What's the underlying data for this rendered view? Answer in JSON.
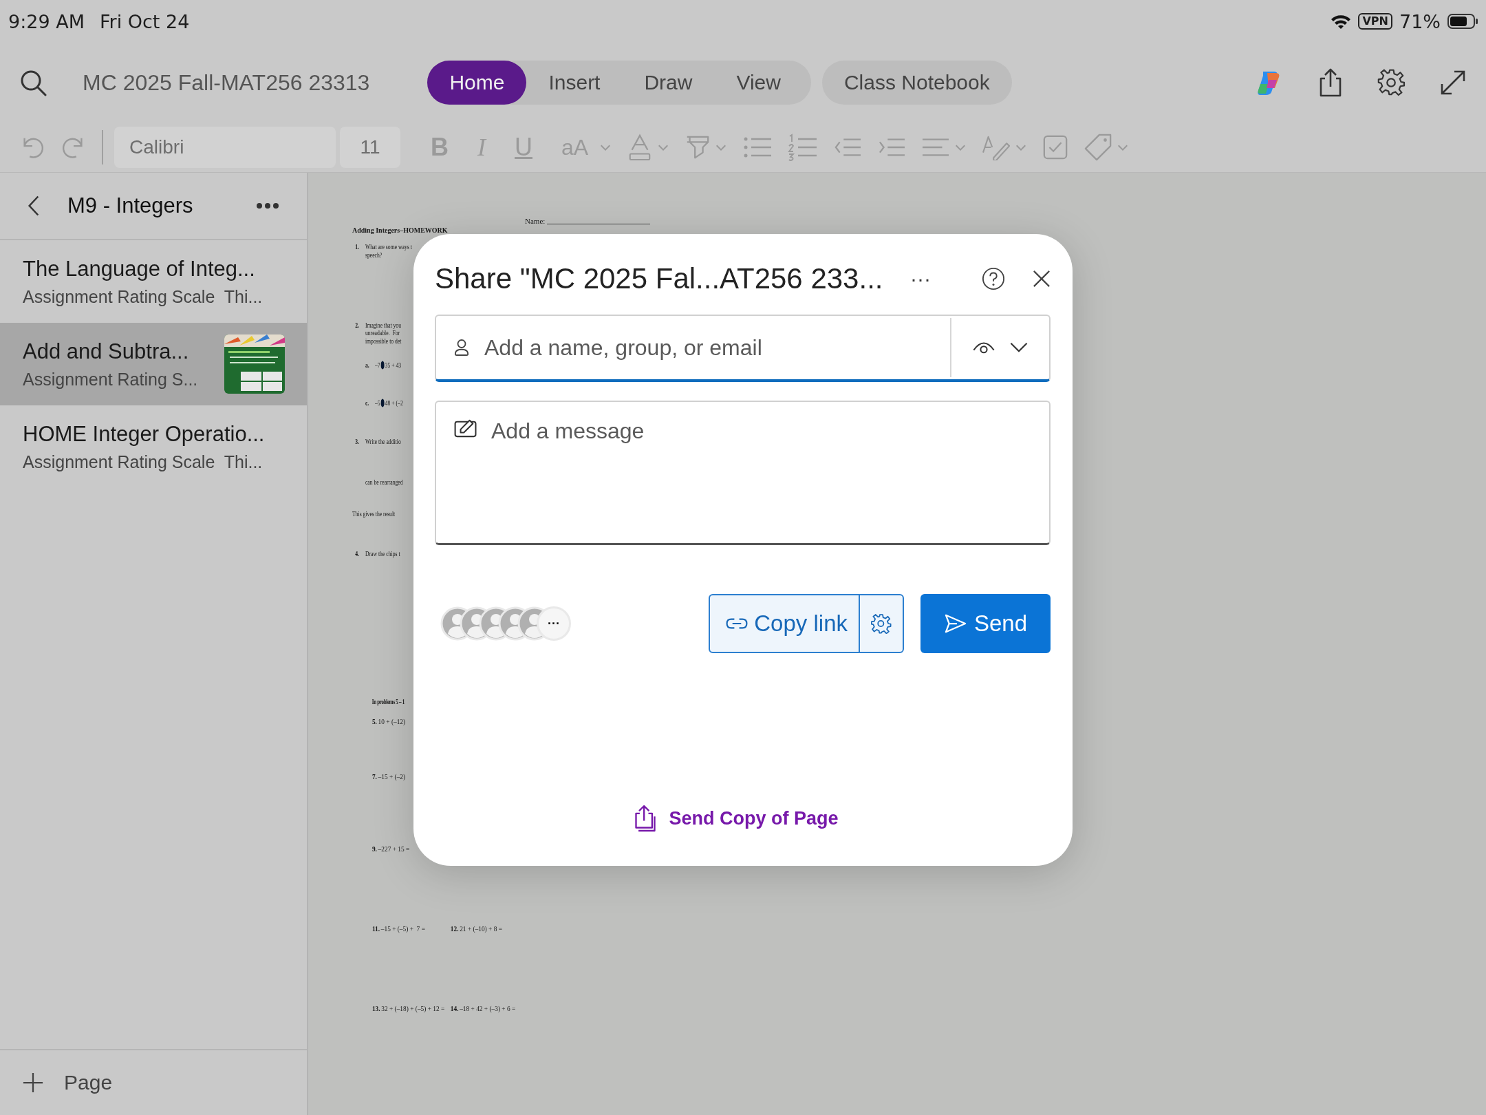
{
  "status_bar": {
    "time": "9:29 AM",
    "date": "Fri Oct 24",
    "vpn": "VPN",
    "battery": "71%"
  },
  "header": {
    "notebook_title": "MC 2025 Fall-MAT256 23313",
    "tabs": [
      {
        "label": "Home",
        "selected": true
      },
      {
        "label": "Insert",
        "selected": false
      },
      {
        "label": "Draw",
        "selected": false
      },
      {
        "label": "View",
        "selected": false
      }
    ],
    "class_notebook": "Class Notebook"
  },
  "toolbar": {
    "disabled": true,
    "font": "Calibri",
    "size": "11",
    "format_buttons": [
      {
        "kind": "bold",
        "label": "B"
      },
      {
        "kind": "italic",
        "label": "I"
      },
      {
        "kind": "underline",
        "label": "U"
      },
      {
        "kind": "case",
        "label": "aA"
      }
    ]
  },
  "sidebar": {
    "section": "M9 - Integers",
    "pages": [
      {
        "title": "The Language of Integ...",
        "subtitle": "Assignment Rating Scale  Thi...",
        "selected": false
      },
      {
        "title": "Add and Subtra...",
        "subtitle": "Assignment Rating S...",
        "selected": true
      },
      {
        "title": "HOME Integer Operatio...",
        "subtitle": "Assignment Rating Scale  Thi...",
        "selected": false
      }
    ],
    "add_page": "Page"
  },
  "document": {
    "name_label": "Name:",
    "heading": "Adding Integers–HOMEWORK",
    "lines": [
      {
        "kind": "item",
        "num": "1.",
        "text": "What are some ways t"
      },
      {
        "kind": "cont",
        "text": "speech?"
      },
      {
        "kind": "item",
        "num": "2.",
        "text": "Imagine that you"
      },
      {
        "kind": "cont",
        "text": "unreadable.  For"
      },
      {
        "kind": "cont",
        "text": "impossible to det"
      },
      {
        "kind": "blot",
        "num": "a.",
        "before": "–7",
        "after": "35 + 43"
      },
      {
        "kind": "blot",
        "num": "c.",
        "before": "–5",
        "after": "48 + (–2"
      },
      {
        "kind": "item",
        "num": "3.",
        "text": "Write the additio"
      },
      {
        "kind": "cont",
        "text": "can be rearranged"
      },
      {
        "kind": "plain",
        "text": "This gives the result"
      },
      {
        "kind": "item",
        "num": "4.",
        "text": "Draw the chips t"
      },
      {
        "kind": "section",
        "text": "In problems 5 – 1"
      },
      {
        "kind": "problem",
        "problems": [
          {
            "num": "5.",
            "text": "10 + (–12)"
          }
        ]
      },
      {
        "kind": "problem",
        "problems": [
          {
            "num": "7.",
            "text": "–15 + (–2)"
          }
        ]
      },
      {
        "kind": "problem",
        "problems": [
          {
            "num": "9.",
            "text": "–227 + 15 ="
          }
        ]
      },
      {
        "kind": "problem",
        "problems": [
          {
            "num": "11.",
            "text": "–15 + (–5) +  7 ="
          },
          {
            "num": "12.",
            "text": "21 + (–10) + 8 ="
          }
        ]
      },
      {
        "kind": "problem",
        "problems": [
          {
            "num": "13.",
            "text": "32 + (–18) + (–5) + 12 ="
          },
          {
            "num": "14.",
            "text": "–18 + 42 + (–3) + 6 ="
          }
        ]
      }
    ]
  },
  "share_dialog": {
    "title": "Share \"MC 2025 Fal...AT256 233...",
    "more": "···",
    "recipient": {
      "placeholder": "Add a name, group, or email"
    },
    "message": {
      "placeholder": "Add a message"
    },
    "more_people": "···",
    "copy_link": "Copy link",
    "send": "Send",
    "send_copy": "Send Copy of Page"
  }
}
